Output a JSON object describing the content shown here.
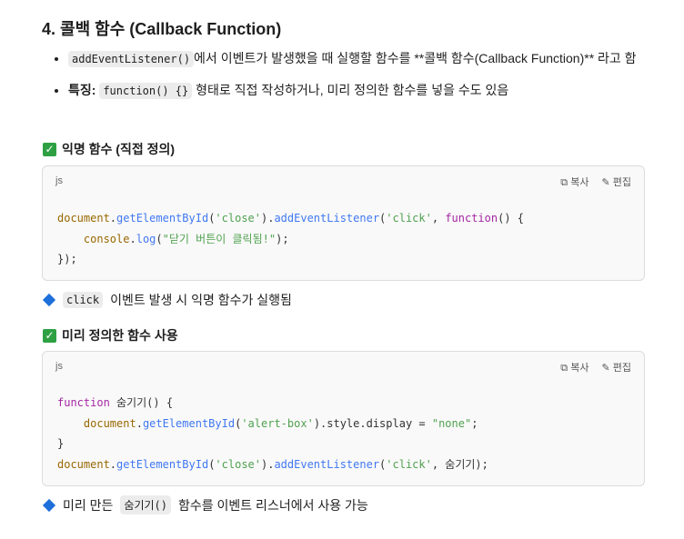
{
  "heading": "4. 콜백 함수 (Callback Function)",
  "bullets": {
    "b1_code": "addEventListener()",
    "b1_text": "에서 이벤트가 발생했을 때 실행할 함수를 **콜백 함수(Callback Function)** 라고 함",
    "b2_label": "특징:",
    "b2_code": "function() {}",
    "b2_text": " 형태로 직접 작성하거나, 미리 정의한 함수를 넣을 수도 있음"
  },
  "section1": {
    "title": "익명 함수 (직접 정의)",
    "note_code": "click",
    "note_text": " 이벤트 발생 시 익명 함수가 실행됨"
  },
  "section2": {
    "title": "미리 정의한 함수 사용",
    "note_pre": "미리 만든 ",
    "note_code": "숨기기()",
    "note_text": " 함수를 이벤트 리스너에서 사용 가능"
  },
  "code_block": {
    "lang": "js",
    "copy": "복사",
    "edit": "편집"
  },
  "code1": [
    [
      [
        "obj",
        "document"
      ],
      [
        "pl",
        "."
      ],
      [
        "fn",
        "getElementById"
      ],
      [
        "pl",
        "("
      ],
      [
        "str",
        "'close'"
      ],
      [
        "pl",
        ")."
      ],
      [
        "fn",
        "addEventListener"
      ],
      [
        "pl",
        "("
      ],
      [
        "str",
        "'click'"
      ],
      [
        "pl",
        ", "
      ],
      [
        "kw",
        "function"
      ],
      [
        "pl",
        "() {"
      ]
    ],
    [
      [
        "pl",
        "    "
      ],
      [
        "obj",
        "console"
      ],
      [
        "pl",
        "."
      ],
      [
        "fn",
        "log"
      ],
      [
        "pl",
        "("
      ],
      [
        "str",
        "\"닫기 버튼이 클릭됨!\""
      ],
      [
        "pl",
        ");"
      ]
    ],
    [
      [
        "pl",
        "});"
      ]
    ]
  ],
  "code2": [
    [
      [
        "kw",
        "function"
      ],
      [
        "pl",
        " 숨기기() {"
      ]
    ],
    [
      [
        "pl",
        "    "
      ],
      [
        "obj",
        "document"
      ],
      [
        "pl",
        "."
      ],
      [
        "fn",
        "getElementById"
      ],
      [
        "pl",
        "("
      ],
      [
        "str",
        "'alert-box'"
      ],
      [
        "pl",
        ").style.display = "
      ],
      [
        "str",
        "\"none\""
      ],
      [
        "pl",
        ";"
      ]
    ],
    [
      [
        "pl",
        "}"
      ]
    ],
    [
      [
        "obj",
        "document"
      ],
      [
        "pl",
        "."
      ],
      [
        "fn",
        "getElementById"
      ],
      [
        "pl",
        "("
      ],
      [
        "str",
        "'close'"
      ],
      [
        "pl",
        ")."
      ],
      [
        "fn",
        "addEventListener"
      ],
      [
        "pl",
        "("
      ],
      [
        "str",
        "'click'"
      ],
      [
        "pl",
        ", 숨기기);"
      ]
    ]
  ]
}
